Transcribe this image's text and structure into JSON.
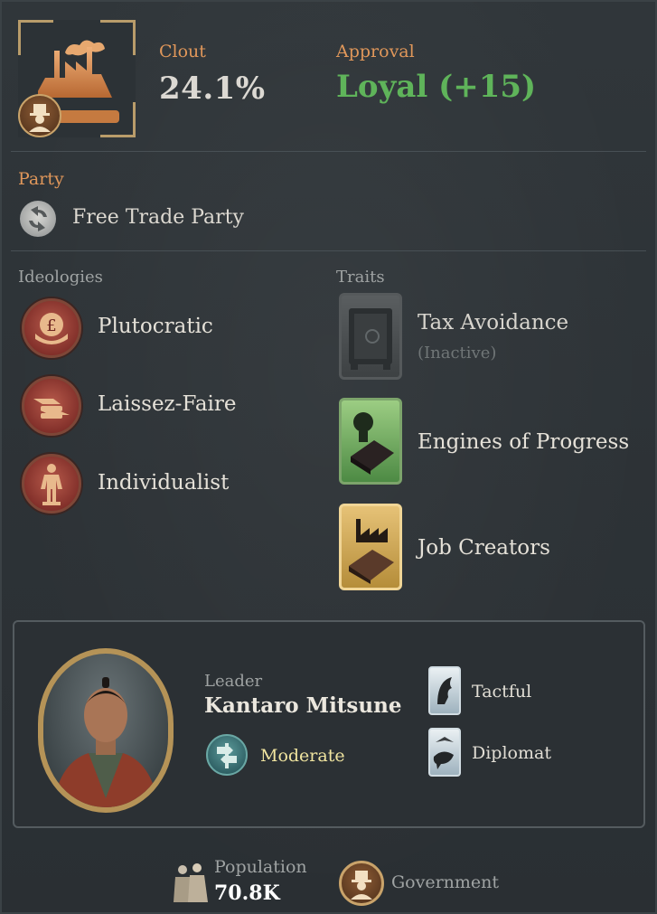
{
  "header": {
    "clout_label": "Clout",
    "clout_value": "24.1%",
    "approval_label": "Approval",
    "approval_value": "Loyal",
    "approval_delta": "(+15)",
    "emblem_icon": "factory-icon",
    "badge_icon": "capitalist-badge-icon"
  },
  "party": {
    "label": "Party",
    "name": "Free Trade Party",
    "icon": "free-trade-party-icon"
  },
  "ideologies": {
    "label": "Ideologies",
    "items": [
      {
        "label": "Plutocratic",
        "icon": "plutocratic-icon"
      },
      {
        "label": "Laissez-Faire",
        "icon": "laissez-faire-icon"
      },
      {
        "label": "Individualist",
        "icon": "individualist-icon"
      }
    ]
  },
  "traits": {
    "label": "Traits",
    "items": [
      {
        "label": "Tax Avoidance",
        "status": "(Inactive)",
        "icon": "safe-icon"
      },
      {
        "label": "Engines of Progress",
        "icon": "lightbulb-icon"
      },
      {
        "label": "Job Creators",
        "icon": "factory-icon"
      }
    ]
  },
  "leader": {
    "label": "Leader",
    "name": "Kantaro Mitsune",
    "stance": "Moderate",
    "stance_icon": "signpost-icon",
    "traits": [
      {
        "label": "Tactful",
        "icon": "tactful-icon"
      },
      {
        "label": "Diplomat",
        "icon": "dove-icon"
      }
    ]
  },
  "footer": {
    "population_label": "Population",
    "population_value": "70.8K",
    "government_label": "Government"
  },
  "colors": {
    "orange_label": "#e0975a",
    "approval_green": "#5fb45a",
    "moderate_yellow": "#f1e5a0"
  }
}
